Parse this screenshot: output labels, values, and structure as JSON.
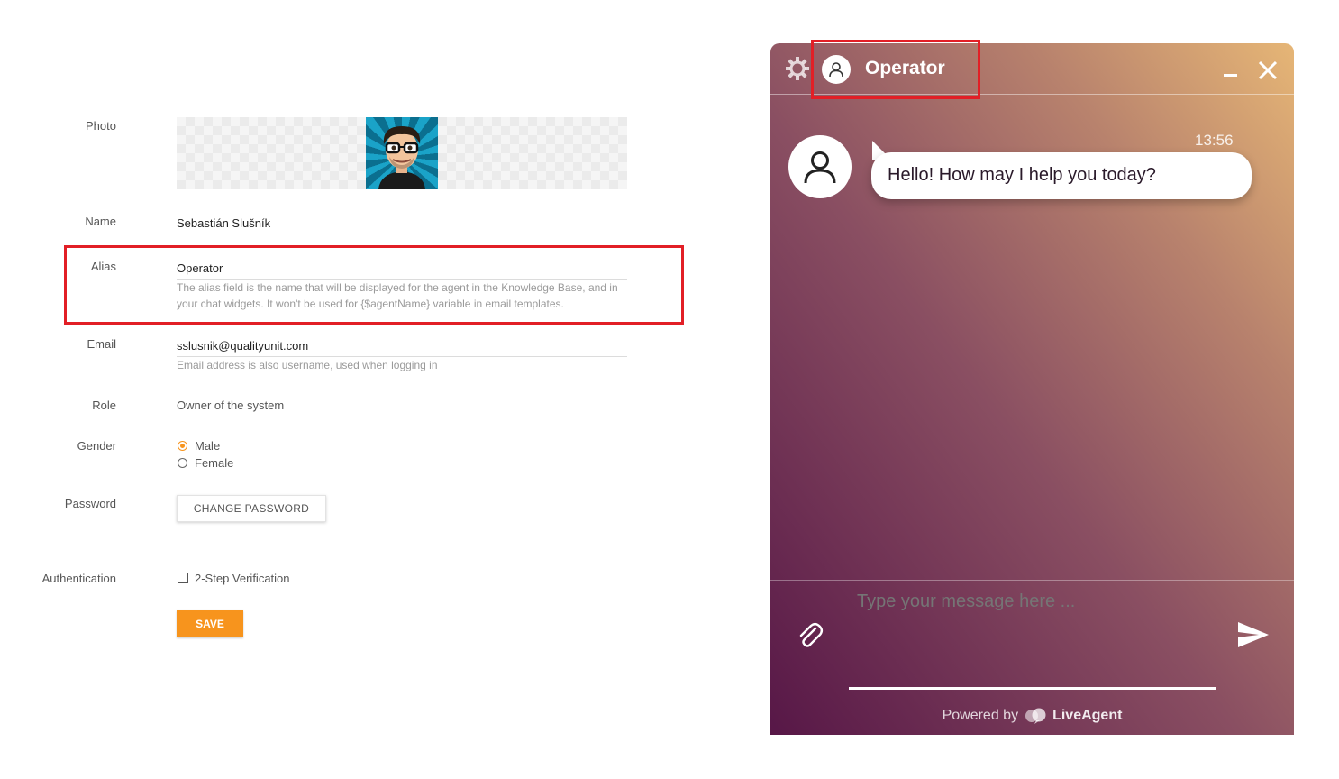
{
  "form": {
    "photo_label": "Photo",
    "name_label": "Name",
    "name_value": "Sebastián Slušník",
    "alias_label": "Alias",
    "alias_value": "Operator",
    "alias_hint_line1": "The alias field is the name that will be displayed for the agent in the Knowledge Base, and in",
    "alias_hint_line2": "your chat widgets. It won't be used for {$agentName} variable in email templates.",
    "email_label": "Email",
    "email_value": "sslusnik@qualityunit.com",
    "email_hint": "Email address is also username, used when logging in",
    "role_label": "Role",
    "role_value": "Owner of the system",
    "gender_label": "Gender",
    "gender_options": [
      "Male",
      "Female"
    ],
    "gender_selected": "Male",
    "password_label": "Password",
    "change_password_label": "CHANGE PASSWORD",
    "authentication_label": "Authentication",
    "two_step_label": "2-Step Verification",
    "two_step_checked": false,
    "save_label": "SAVE"
  },
  "chat": {
    "title": "Operator",
    "message_time": "13:56",
    "message_text": "Hello! How may I help you today?",
    "input_placeholder": "Type your message here ...",
    "powered_by": "Powered by",
    "brand": "LiveAgent",
    "icons": [
      "gear-icon",
      "user-icon",
      "minimize-icon",
      "close-icon",
      "paperclip-icon",
      "send-icon",
      "liveagent-logo-icon"
    ]
  },
  "colors": {
    "accent": "#f7941d",
    "highlight": "#e21f26",
    "chat_gradient_start": "#571747",
    "chat_gradient_end": "#e6b676"
  }
}
